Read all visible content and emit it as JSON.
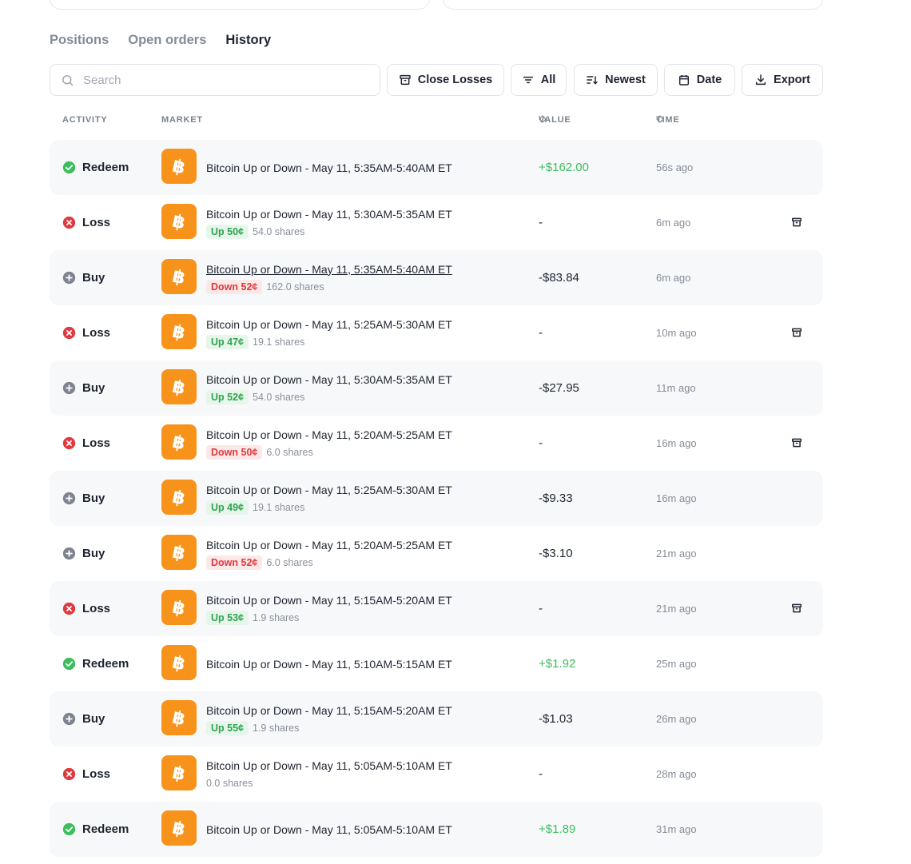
{
  "tabs": [
    "Positions",
    "Open orders",
    "History"
  ],
  "active_tab": "History",
  "search": {
    "placeholder": "Search"
  },
  "toolbar": {
    "close_losses": "Close Losses",
    "all": "All",
    "newest": "Newest",
    "date": "Date",
    "export": "Export"
  },
  "headers": {
    "activity": "ACTIVITY",
    "market": "MARKET",
    "value": "VALUE",
    "time": "TIME"
  },
  "colors": {
    "brand_bitcoin": "#f7931a",
    "positive": "#3dbd5d",
    "negative": "#e0393e",
    "up_pill_text": "#2ea44f"
  },
  "rows": [
    {
      "activity": "Redeem",
      "market": "Bitcoin Up or Down - May 11, 5:35AM-5:40AM ET",
      "value": "+$162.00",
      "time": "56s ago"
    },
    {
      "activity": "Loss",
      "market": "Bitcoin Up or Down - May 11, 5:30AM-5:35AM ET",
      "outcome": "Up 50¢",
      "shares": "54.0 shares",
      "value": "-",
      "time": "6m ago"
    },
    {
      "activity": "Buy",
      "market": "Bitcoin Up or Down - May 11, 5:35AM-5:40AM ET",
      "outcome": "Down 52¢",
      "shares": "162.0 shares",
      "value": "-$83.84",
      "time": "6m ago"
    },
    {
      "activity": "Loss",
      "market": "Bitcoin Up or Down - May 11, 5:25AM-5:30AM ET",
      "outcome": "Up 47¢",
      "shares": "19.1 shares",
      "value": "-",
      "time": "10m ago"
    },
    {
      "activity": "Buy",
      "market": "Bitcoin Up or Down - May 11, 5:30AM-5:35AM ET",
      "outcome": "Up 52¢",
      "shares": "54.0 shares",
      "value": "-$27.95",
      "time": "11m ago"
    },
    {
      "activity": "Loss",
      "market": "Bitcoin Up or Down - May 11, 5:20AM-5:25AM ET",
      "outcome": "Down 50¢",
      "shares": "6.0 shares",
      "value": "-",
      "time": "16m ago"
    },
    {
      "activity": "Buy",
      "market": "Bitcoin Up or Down - May 11, 5:25AM-5:30AM ET",
      "outcome": "Up 49¢",
      "shares": "19.1 shares",
      "value": "-$9.33",
      "time": "16m ago"
    },
    {
      "activity": "Buy",
      "market": "Bitcoin Up or Down - May 11, 5:20AM-5:25AM ET",
      "outcome": "Down 52¢",
      "shares": "6.0 shares",
      "value": "-$3.10",
      "time": "21m ago"
    },
    {
      "activity": "Loss",
      "market": "Bitcoin Up or Down - May 11, 5:15AM-5:20AM ET",
      "outcome": "Up 53¢",
      "shares": "1.9 shares",
      "value": "-",
      "time": "21m ago"
    },
    {
      "activity": "Redeem",
      "market": "Bitcoin Up or Down - May 11, 5:10AM-5:15AM ET",
      "value": "+$1.92",
      "time": "25m ago"
    },
    {
      "activity": "Buy",
      "market": "Bitcoin Up or Down - May 11, 5:15AM-5:20AM ET",
      "outcome": "Up 55¢",
      "shares": "1.9 shares",
      "value": "-$1.03",
      "time": "26m ago"
    },
    {
      "activity": "Loss",
      "market": "Bitcoin Up or Down - May 11, 5:05AM-5:10AM ET",
      "shares": "0.0 shares",
      "value": "-",
      "time": "28m ago"
    },
    {
      "activity": "Redeem",
      "market": "Bitcoin Up or Down - May 11, 5:05AM-5:10AM ET",
      "value": "+$1.89",
      "time": "31m ago"
    }
  ]
}
